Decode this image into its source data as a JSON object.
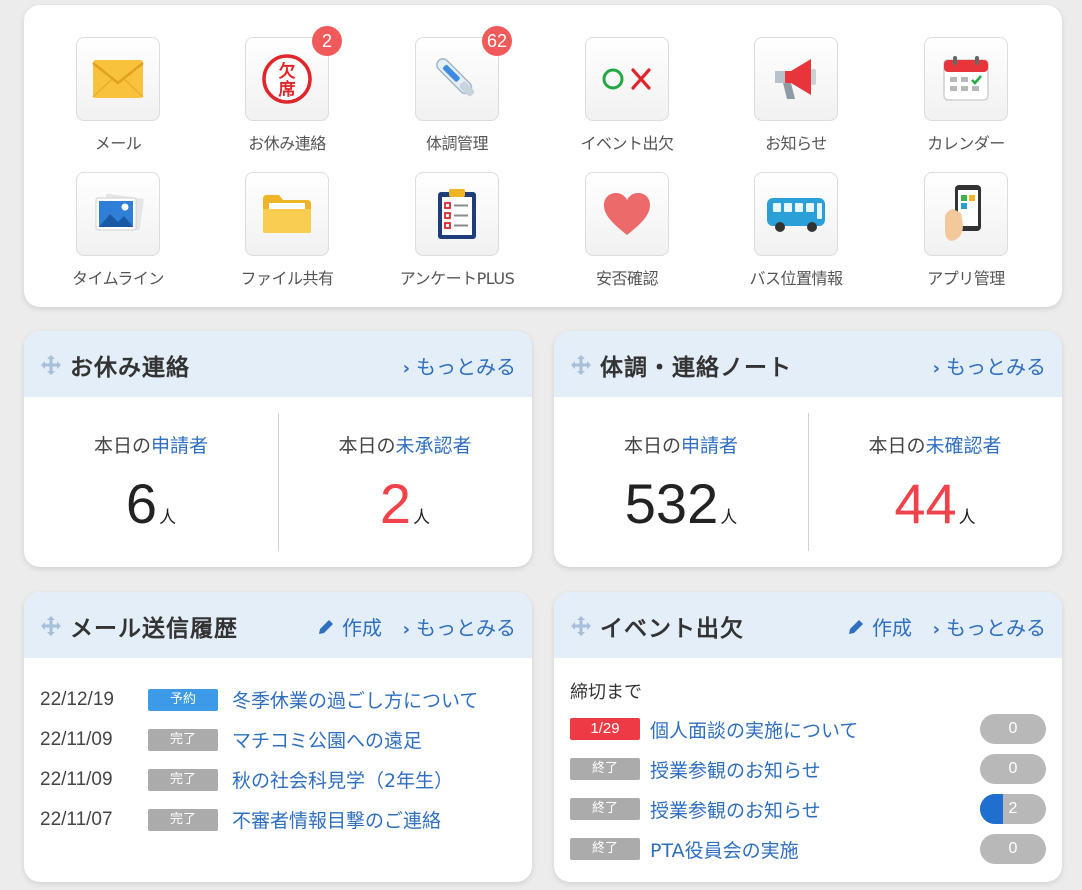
{
  "apps": [
    {
      "label": "メール",
      "icon": "mail-icon"
    },
    {
      "label": "お休み連絡",
      "icon": "absence-stamp-icon",
      "count": "2"
    },
    {
      "label": "体調管理",
      "icon": "thermometer-icon",
      "count": "62"
    },
    {
      "label": "イベント出欠",
      "icon": "attendance-ox-icon"
    },
    {
      "label": "お知らせ",
      "icon": "megaphone-icon"
    },
    {
      "label": "カレンダー",
      "icon": "calendar-icon"
    },
    {
      "label": "タイムライン",
      "icon": "photo-icon"
    },
    {
      "label": "ファイル共有",
      "icon": "folder-icon"
    },
    {
      "label": "アンケートPLUS",
      "icon": "clipboard-icon"
    },
    {
      "label": "安否確認",
      "icon": "heart-icon"
    },
    {
      "label": "バス位置情報",
      "icon": "bus-icon"
    },
    {
      "label": "アプリ管理",
      "icon": "smartphone-icon"
    }
  ],
  "absence": {
    "title": "お休み連絡",
    "more": "もっとみる",
    "left_label_prefix": "本日の",
    "left_label_hl": "申請者",
    "left_value": "6",
    "right_label_prefix": "本日の",
    "right_label_hl": "未承認者",
    "right_value": "2",
    "unit": "人"
  },
  "health": {
    "title": "体調・連絡ノート",
    "more": "もっとみる",
    "left_label_prefix": "本日の",
    "left_label_hl": "申請者",
    "left_value": "532",
    "right_label_prefix": "本日の",
    "right_label_hl": "未確認者",
    "right_value": "44",
    "unit": "人"
  },
  "mail_history": {
    "title": "メール送信履歴",
    "create": "作成",
    "more": "もっとみる",
    "rows": [
      {
        "date": "22/12/19",
        "status": "予約",
        "status_type": "blue",
        "subject": "冬季休業の過ごし方について"
      },
      {
        "date": "22/11/09",
        "status": "完了",
        "status_type": "gray",
        "subject": "マチコミ公園への遠足"
      },
      {
        "date": "22/11/09",
        "status": "完了",
        "status_type": "gray",
        "subject": "秋の社会科見学（2年生）"
      },
      {
        "date": "22/11/07",
        "status": "完了",
        "status_type": "gray",
        "subject": "不審者情報目撃のご連絡"
      }
    ]
  },
  "events": {
    "title": "イベント出欠",
    "create": "作成",
    "more": "もっとみる",
    "deadline_label": "締切まで",
    "rows": [
      {
        "badge": "1/29",
        "badge_type": "red",
        "subject": "個人面談の実施について",
        "count": "0",
        "progress": 0
      },
      {
        "badge": "終了",
        "badge_type": "gray",
        "subject": "授業参観のお知らせ",
        "count": "0",
        "progress": 0
      },
      {
        "badge": "終了",
        "badge_type": "gray",
        "subject": "授業参観のお知らせ",
        "count": "2",
        "progress": 0.35
      },
      {
        "badge": "終了",
        "badge_type": "gray",
        "subject": "PTA役員会の実施",
        "count": "0",
        "progress": 0
      }
    ]
  },
  "colors": {
    "accent": "#2f6fc0",
    "alert": "#f0424a",
    "badge_blue": "#3d9ae8",
    "badge_gray": "#ababab",
    "header_bg": "#e4eef9"
  }
}
